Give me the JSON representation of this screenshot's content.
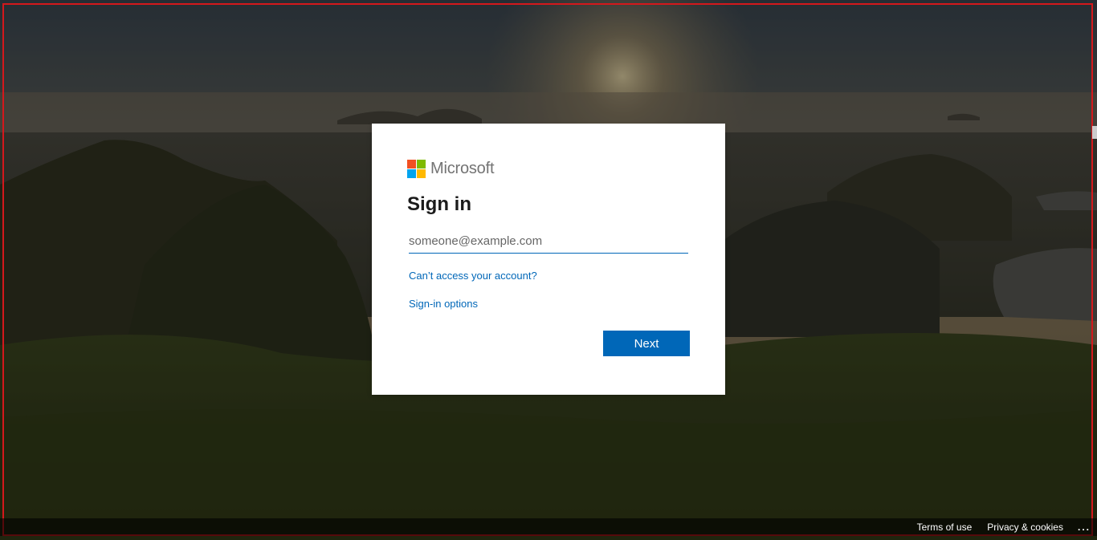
{
  "brand": {
    "name": "Microsoft",
    "logo_colors": [
      "#f25022",
      "#7fba00",
      "#00a4ef",
      "#ffb900"
    ]
  },
  "signin": {
    "title": "Sign in",
    "email_placeholder": "someone@example.com",
    "email_value": "",
    "cant_access_link": "Can’t access your account?",
    "signin_options_link": "Sign-in options",
    "next_button": "Next"
  },
  "footer": {
    "terms": "Terms of use",
    "privacy": "Privacy & cookies",
    "more": "..."
  },
  "theme": {
    "accent": "#0067b8",
    "frame_border": "#d4181c"
  }
}
